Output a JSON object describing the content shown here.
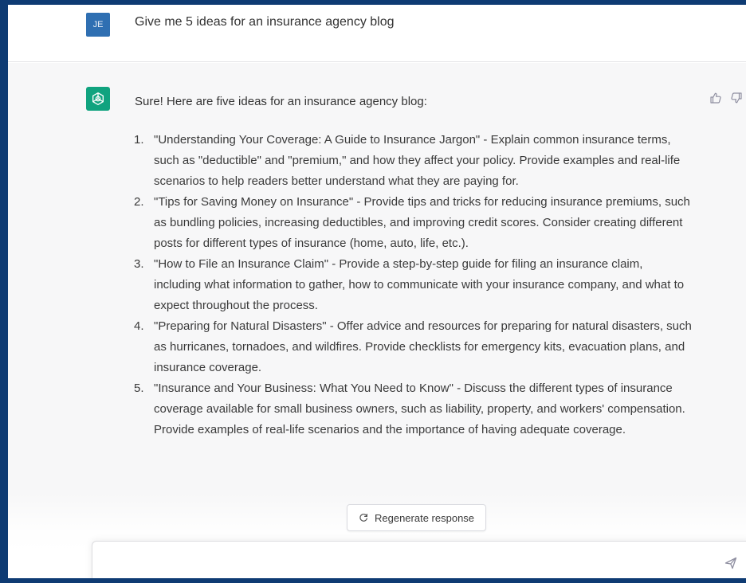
{
  "user_message": {
    "avatar_initials": "JE",
    "text": "Give me 5 ideas for an insurance agency blog"
  },
  "assistant_message": {
    "intro": "Sure! Here are five ideas for an insurance agency blog:",
    "ideas": [
      {
        "num": "1.",
        "text": "\"Understanding Your Coverage: A Guide to Insurance Jargon\" - Explain common insurance terms, such as \"deductible\" and \"premium,\" and how they affect your policy. Provide examples and real-life scenarios to help readers better understand what they are paying for."
      },
      {
        "num": "2.",
        "text": "\"Tips for Saving Money on Insurance\" - Provide tips and tricks for reducing insurance premiums, such as bundling policies, increasing deductibles, and improving credit scores. Consider creating different posts for different types of insurance (home, auto, life, etc.)."
      },
      {
        "num": "3.",
        "text": "\"How to File an Insurance Claim\" - Provide a step-by-step guide for filing an insurance claim, including what information to gather, how to communicate with your insurance company, and what to expect throughout the process."
      },
      {
        "num": "4.",
        "text": "\"Preparing for Natural Disasters\" - Offer advice and resources for preparing for natural disasters, such as hurricanes, tornadoes, and wildfires. Provide checklists for emergency kits, evacuation plans, and insurance coverage."
      },
      {
        "num": "5.",
        "text": "\"Insurance and Your Business: What You Need to Know\" - Discuss the different types of insurance coverage available for small business owners, such as liability, property, and workers' compensation. Provide examples of real-life scenarios and the importance of having adequate coverage."
      }
    ]
  },
  "regenerate_label": "Regenerate response",
  "input": {
    "placeholder": ""
  },
  "colors": {
    "user_avatar": "#2f6fb2",
    "bot_avatar": "#10a37f",
    "frame": "#0e3b73"
  }
}
